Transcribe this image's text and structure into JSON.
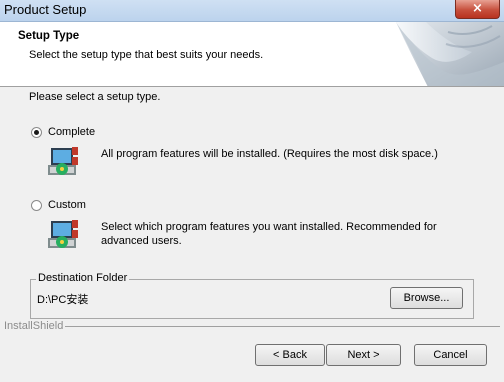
{
  "window": {
    "title": "Product Setup",
    "close_glyph": "×"
  },
  "header": {
    "title": "Setup Type",
    "subtitle": "Select the setup type that best suits your needs."
  },
  "prompt": "Please select a setup type.",
  "options": [
    {
      "label": "Complete",
      "description": "All program features will be installed. (Requires the most disk space.)",
      "selected": true,
      "icon": "computer-install-icon"
    },
    {
      "label": "Custom",
      "description_line1": "Select which program features you want installed. Recommended for",
      "description_line2": "advanced users.",
      "selected": false,
      "icon": "computer-install-icon"
    }
  ],
  "destination": {
    "group_label": "Destination Folder",
    "path": "D:\\PC安装",
    "browse_label": "Browse..."
  },
  "brand": "InstallShield",
  "footer": {
    "back_label": "< Back",
    "next_label": "Next >",
    "cancel_label": "Cancel"
  }
}
